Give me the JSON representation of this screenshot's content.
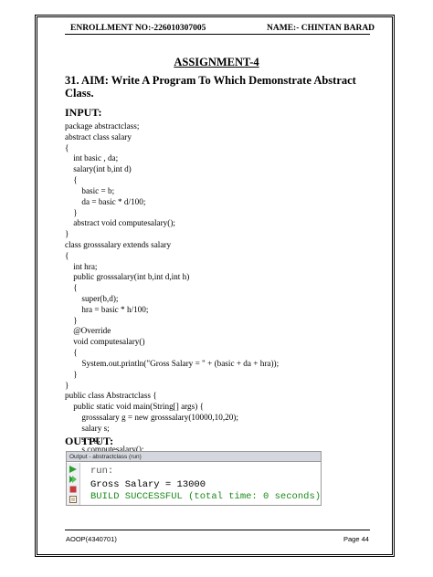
{
  "header": {
    "enrollment": "ENROLLMENT NO:-226010307005",
    "name": "NAME:- CHINTAN BARAD"
  },
  "assignment_title": "ASSIGNMENT-4",
  "aim": "31. AIM: Write A Program To Which Demonstrate Abstract Class.",
  "input_label": "INPUT:",
  "code_lines": [
    "package abstractclass;",
    "abstract class salary",
    "{",
    "    int basic , da;",
    "    salary(int b,int d)",
    "    {",
    "        basic = b;",
    "        da = basic * d/100;",
    "    }",
    "    abstract void computesalary();",
    "}",
    "class grosssalary extends salary",
    "{",
    "    int hra;",
    "    public grosssalary(int b,int d,int h)",
    "    {",
    "        super(b,d);",
    "        hra = basic * h/100;",
    "    }",
    "    @Override",
    "    void computesalary()",
    "    {",
    "        System.out.println(\"Gross Salary = \" + (basic + da + hra));",
    "    }",
    "}",
    "public class Abstractclass {",
    "    public static void main(String[] args) {",
    "        grosssalary g = new grosssalary(10000,10,20);",
    "        salary s;",
    "        s = g;",
    "        s.computesalary();",
    "    }",
    "}"
  ],
  "output_label": "OUTPUT:",
  "console": {
    "title": "Output - abstractclass (run)",
    "lines": {
      "run": "run:",
      "result": "Gross Salary = 13000",
      "build": "BUILD SUCCESSFUL (total time: 0 seconds)"
    },
    "icons": [
      "run-icon",
      "rerun-icon",
      "stop-icon",
      "clear-icon"
    ],
    "colors": {
      "build_text": "#1b8a1b",
      "titlebar": "#d4d8de"
    }
  },
  "footer": {
    "course": "AOOP(4340701)",
    "page": "Page 44"
  }
}
